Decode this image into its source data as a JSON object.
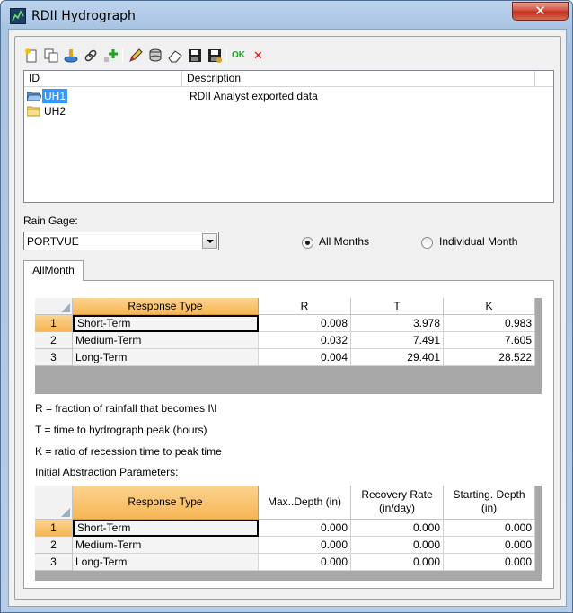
{
  "window": {
    "title": "RDII Hydrograph",
    "close_glyph": "✕"
  },
  "toolbar": {
    "icons": [
      "new-icon",
      "copy-icon",
      "import-icon",
      "link-icon",
      "add-icon",
      "edit-icon",
      "stack-icon",
      "eraser-icon",
      "save-icon",
      "save-as-icon",
      "ok-icon",
      "cancel-icon"
    ],
    "ok_label": "OK",
    "cancel_glyph": "✕"
  },
  "unit_hydrographs": {
    "columns": [
      "ID",
      "Description"
    ],
    "rows": [
      {
        "id": "UH1",
        "description": "RDII Analyst exported data",
        "selected": true
      },
      {
        "id": "UH2",
        "description": "",
        "selected": false
      }
    ]
  },
  "rain_gage": {
    "label": "Rain Gage:",
    "value": "PORTVUE"
  },
  "months": {
    "all_label": "All Months",
    "individual_label": "Individual Month",
    "selected": "all"
  },
  "tabs": [
    {
      "label": "AllMonth"
    }
  ],
  "response_table": {
    "headers": [
      "Response Type",
      "R",
      "T",
      "K"
    ],
    "rows": [
      {
        "num": "1",
        "type": "Short-Term",
        "r": "0.008",
        "t": "3.978",
        "k": "0.983"
      },
      {
        "num": "2",
        "type": "Medium-Term",
        "r": "0.032",
        "t": "7.491",
        "k": "7.605"
      },
      {
        "num": "3",
        "type": "Long-Term",
        "r": "0.004",
        "t": "29.401",
        "k": "28.522"
      }
    ]
  },
  "notes": {
    "r": "R = fraction of rainfall that becomes I\\I",
    "t": "T = time to hydrograph peak (hours)",
    "k": "K = ratio of recession time to peak time",
    "ia": "Initial Abstraction Parameters:"
  },
  "abstraction_table": {
    "headers": [
      "Response Type",
      "Max..Depth (in)",
      "Recovery Rate\n(in/day)",
      "Starting. Depth\n(in)"
    ],
    "rows": [
      {
        "num": "1",
        "type": "Short-Term",
        "max": "0.000",
        "rec": "0.000",
        "start": "0.000"
      },
      {
        "num": "2",
        "type": "Medium-Term",
        "max": "0.000",
        "rec": "0.000",
        "start": "0.000"
      },
      {
        "num": "3",
        "type": "Long-Term",
        "max": "0.000",
        "rec": "0.000",
        "start": "0.000"
      }
    ]
  },
  "colors": {
    "selection": "#3399ff",
    "header_highlight": "#f6b655",
    "ok_green": "#17a817",
    "cancel_red": "#e01010"
  }
}
